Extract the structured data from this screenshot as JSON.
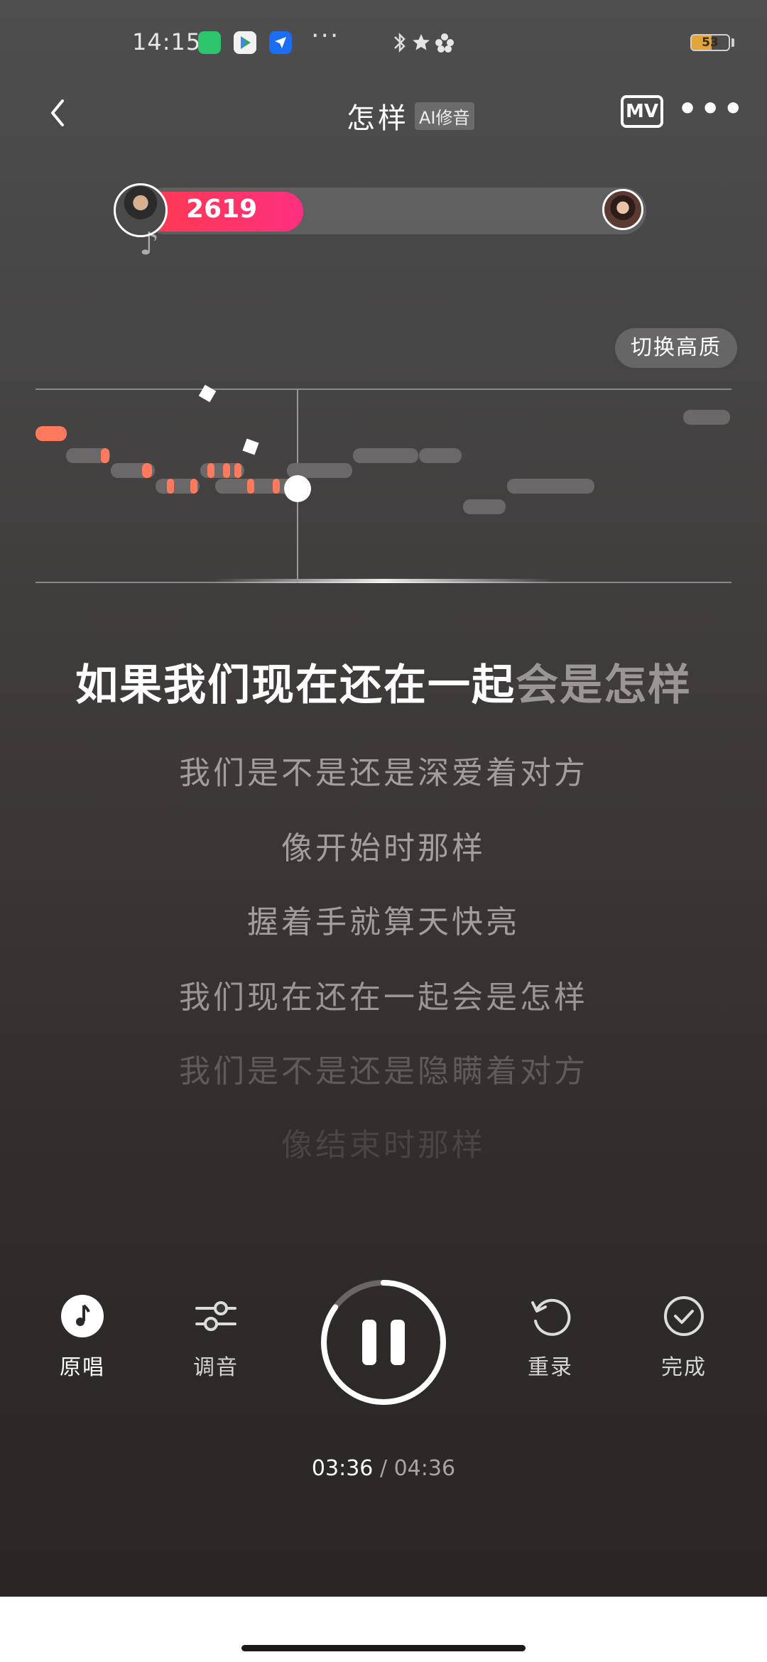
{
  "status_bar": {
    "time": "14:15",
    "more": "···",
    "battery": "53",
    "battery_level_percent": 53,
    "icons": [
      "app-shield-icon",
      "google-play-icon",
      "send-app-icon",
      "bluetooth-icon",
      "star-icon",
      "flower-icon",
      "battery-icon"
    ]
  },
  "header": {
    "title": "怎样",
    "ai_badge": "AI修音",
    "mv_label": "MV",
    "more": "•••"
  },
  "score": {
    "value": "2619",
    "progress_fraction": 0.32
  },
  "quality_button": "切换高质",
  "lyrics": {
    "current_sung": "如果我们现在还在一起",
    "current_upcoming": "会是怎样",
    "lines": [
      "我们是不是还是深爱着对方",
      "像开始时那样",
      "握着手就算天快亮",
      "我们现在还在一起会是怎样",
      "我们是不是还是隐瞒着对方",
      "像结束时那样"
    ]
  },
  "controls": {
    "original": "原唱",
    "tuning": "调音",
    "rerecord": "重录",
    "done": "完成",
    "play_progress_fraction": 0.85
  },
  "time": {
    "current": "03:36",
    "separator": "/",
    "total": "04:36"
  },
  "colors": {
    "score_fill": "#ff2f6d",
    "note_hit": "#ff7a5c",
    "note_pending": "#6a6868"
  }
}
